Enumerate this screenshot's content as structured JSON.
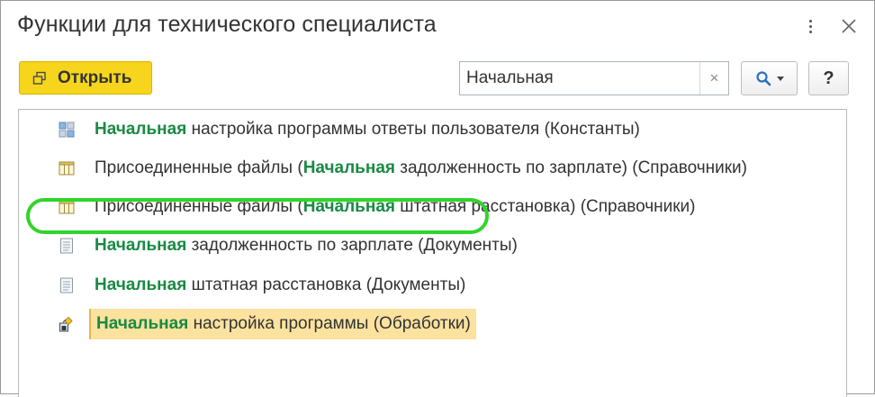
{
  "window": {
    "title": "Функции для технического специалиста",
    "more_icon": "more-vertical-icon",
    "close_icon": "close-icon"
  },
  "toolbar": {
    "open_label": "Открыть",
    "open_icon": "open-window-icon",
    "search_value": "Начальная",
    "clear_icon": "clear-x-icon",
    "search_icon": "magnifier-icon",
    "dropdown_icon": "chevron-down-icon",
    "help_label": "?"
  },
  "colors": {
    "highlight_text": "#198a43",
    "open_button": "#f7d51d",
    "selected_row": "#fce29f",
    "annotation_ring": "#31d42b"
  },
  "results": [
    {
      "icon": "constants-icon",
      "parts": [
        {
          "t": "Начальная",
          "hl": true
        },
        {
          "t": " настройка программы ответы пользователя (Константы)",
          "hl": false
        }
      ]
    },
    {
      "icon": "catalog-icon",
      "parts": [
        {
          "t": "Присоединенные файлы (",
          "hl": false
        },
        {
          "t": "Начальная",
          "hl": true
        },
        {
          "t": " задолженность по зарплате) (Справочники)",
          "hl": false
        }
      ]
    },
    {
      "icon": "catalog-icon",
      "parts": [
        {
          "t": "Присоединенные файлы (",
          "hl": false
        },
        {
          "t": "Начальная",
          "hl": true
        },
        {
          "t": " штатная расстановка) (Справочники)",
          "hl": false
        }
      ]
    },
    {
      "icon": "document-icon",
      "parts": [
        {
          "t": "Начальная",
          "hl": true
        },
        {
          "t": " задолженность по зарплате (Документы)",
          "hl": false
        }
      ]
    },
    {
      "icon": "document-icon",
      "parts": [
        {
          "t": "Начальная",
          "hl": true
        },
        {
          "t": " штатная расстановка (Документы)",
          "hl": false
        }
      ]
    },
    {
      "icon": "data-processor-icon",
      "selected": true,
      "parts": [
        {
          "t": "Начальная",
          "hl": true
        },
        {
          "t": " настройка программы (Обработки)",
          "hl": false
        }
      ]
    }
  ]
}
